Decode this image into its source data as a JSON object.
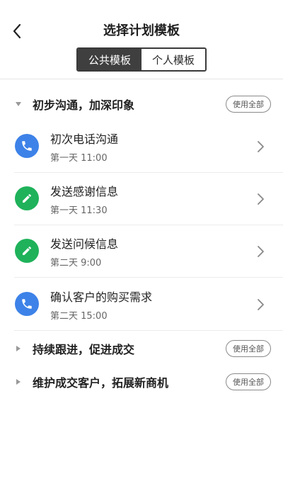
{
  "header": {
    "title": "选择计划模板",
    "tabs": [
      {
        "label": "公共模板",
        "active": true
      },
      {
        "label": "个人模板",
        "active": false
      }
    ]
  },
  "groups": [
    {
      "title": "初步沟通，加深印象",
      "expanded": true,
      "use_all_label": "使用全部",
      "items": [
        {
          "title": "初次电话沟通",
          "time": "第一天 11:00",
          "icon": "phone-icon",
          "color": "#3d82e8"
        },
        {
          "title": "发送感谢信息",
          "time": "第一天 11:30",
          "icon": "pencil-icon",
          "color": "#1fb25a"
        },
        {
          "title": "发送问候信息",
          "time": "第二天 9:00",
          "icon": "pencil-icon",
          "color": "#1fb25a"
        },
        {
          "title": "确认客户的购买需求",
          "time": "第二天 15:00",
          "icon": "phone-icon",
          "color": "#3d82e8"
        }
      ]
    },
    {
      "title": "持续跟进，促进成交",
      "expanded": false,
      "use_all_label": "使用全部"
    },
    {
      "title": "维护成交客户，拓展新商机",
      "expanded": false,
      "use_all_label": "使用全部"
    }
  ]
}
